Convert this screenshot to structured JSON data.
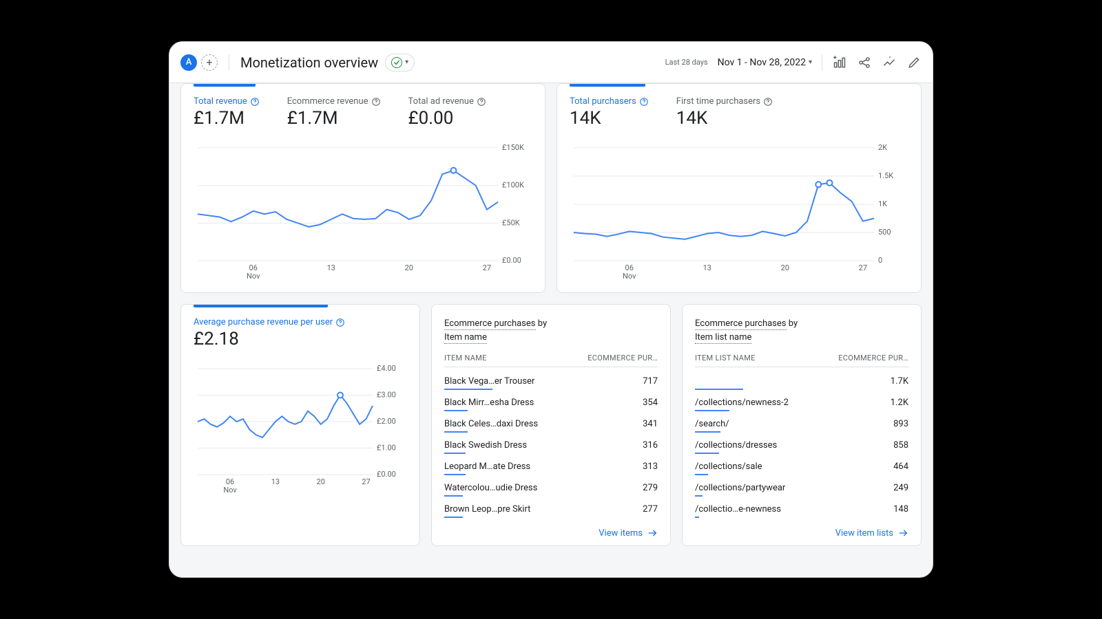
{
  "header": {
    "avatar_letter": "A",
    "title": "Monetization overview",
    "last_label": "Last 28 days",
    "date_range": "Nov 1 - Nov 28, 2022"
  },
  "card_revenue": {
    "metrics": [
      {
        "label": "Total revenue",
        "value": "£1.7M",
        "active": true
      },
      {
        "label": "Ecommerce revenue",
        "value": "£1.7M",
        "active": false
      },
      {
        "label": "Total ad revenue",
        "value": "£0.00",
        "active": false
      }
    ]
  },
  "card_purchasers": {
    "metrics": [
      {
        "label": "Total purchasers",
        "value": "14K",
        "active": true
      },
      {
        "label": "First time purchasers",
        "value": "14K",
        "active": false
      }
    ]
  },
  "card_arpu": {
    "metrics": [
      {
        "label": "Average purchase revenue per user",
        "value": "£2.18",
        "active": true
      }
    ]
  },
  "table_items": {
    "title_prefix": "Ecommerce purchases",
    "title_by": "by",
    "title_dim": "Item name",
    "col1": "ITEM NAME",
    "col2": "ECOMMERCE PUR…",
    "rows": [
      {
        "name": "Black Vega…er Trouser",
        "val": "717",
        "bar": 100
      },
      {
        "name": "Black Mirr…esha Dress",
        "val": "354",
        "bar": 49
      },
      {
        "name": "Black Celes…daxi Dress",
        "val": "341",
        "bar": 48
      },
      {
        "name": "Black Swedish Dress",
        "val": "316",
        "bar": 44
      },
      {
        "name": "Leopard M…ate Dress",
        "val": "313",
        "bar": 44
      },
      {
        "name": "Watercolou…udie Dress",
        "val": "279",
        "bar": 39
      },
      {
        "name": "Brown Leop…pre Skirt",
        "val": "277",
        "bar": 39
      }
    ],
    "view": "View items"
  },
  "table_lists": {
    "title_prefix": "Ecommerce purchases",
    "title_by": "by",
    "title_dim": "Item list name",
    "col1": "ITEM LIST NAME",
    "col2": "ECOMMERCE PUR…",
    "rows": [
      {
        "name": "",
        "val": "1.7K",
        "bar": 100
      },
      {
        "name": "/collections/newness-2",
        "val": "1.2K",
        "bar": 71
      },
      {
        "name": "/search/",
        "val": "893",
        "bar": 53
      },
      {
        "name": "/collections/dresses",
        "val": "858",
        "bar": 50
      },
      {
        "name": "/collections/sale",
        "val": "464",
        "bar": 27
      },
      {
        "name": "/collections/partywear",
        "val": "249",
        "bar": 15
      },
      {
        "name": "/collectio…e-newness",
        "val": "148",
        "bar": 9
      }
    ],
    "view": "View item lists"
  },
  "chart_data": [
    {
      "id": "revenue",
      "type": "line",
      "xlabel": "Nov",
      "x_ticks": [
        "06",
        "13",
        "20",
        "27"
      ],
      "y_ticks": [
        "£0.00",
        "£50K",
        "£100K",
        "£150K"
      ],
      "ylim": [
        0,
        150000
      ],
      "series": [
        {
          "name": "Total revenue",
          "color": "#4285f4",
          "values": [
            62000,
            60000,
            58000,
            52000,
            58000,
            66000,
            62000,
            65000,
            55000,
            50000,
            45000,
            48000,
            55000,
            62000,
            56000,
            55000,
            56000,
            68000,
            64000,
            55000,
            60000,
            80000,
            115000,
            120000,
            110000,
            100000,
            68000,
            78000
          ]
        }
      ],
      "highlight_index": 23
    },
    {
      "id": "purchasers",
      "type": "line",
      "xlabel": "Nov",
      "x_ticks": [
        "06",
        "13",
        "20",
        "27"
      ],
      "y_ticks": [
        "0",
        "500",
        "1K",
        "1.5K",
        "2K"
      ],
      "ylim": [
        0,
        2000
      ],
      "series": [
        {
          "name": "Total purchasers",
          "color": "#4285f4",
          "values": [
            500,
            480,
            470,
            430,
            470,
            520,
            500,
            480,
            420,
            400,
            380,
            430,
            480,
            500,
            450,
            430,
            450,
            520,
            480,
            440,
            500,
            700,
            1350,
            1380,
            1200,
            1050,
            700,
            750
          ]
        }
      ],
      "highlight_index": [
        22,
        23
      ]
    },
    {
      "id": "arpu",
      "type": "line",
      "xlabel": "Nov",
      "x_ticks": [
        "06",
        "13",
        "20",
        "27"
      ],
      "y_ticks": [
        "£0.00",
        "£1.00",
        "£2.00",
        "£3.00",
        "£4.00"
      ],
      "ylim": [
        0,
        4
      ],
      "series": [
        {
          "name": "ARPU",
          "color": "#4285f4",
          "values": [
            2.0,
            2.1,
            1.9,
            1.8,
            1.95,
            2.2,
            2.0,
            2.1,
            1.7,
            1.5,
            1.4,
            1.7,
            2.0,
            2.2,
            2.0,
            1.9,
            2.0,
            2.4,
            2.2,
            1.9,
            2.1,
            2.6,
            3.0,
            2.7,
            2.3,
            1.9,
            2.1,
            2.6
          ]
        }
      ],
      "highlight_index": 22
    }
  ]
}
